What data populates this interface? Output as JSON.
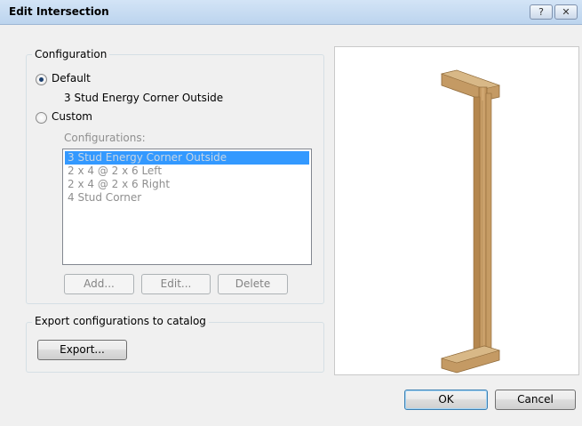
{
  "window": {
    "title": "Edit Intersection",
    "help_glyph": "?",
    "close_glyph": "✕"
  },
  "configuration": {
    "group_label": "Configuration",
    "default_label": "Default",
    "default_value": "3 Stud Energy Corner Outside",
    "custom_label": "Custom",
    "list_label": "Configurations:",
    "items": [
      "3 Stud Energy Corner Outside",
      "2 x 4 @ 2 x 6 Left",
      "2 x 4 @ 2 x 6 Right",
      "4 Stud Corner"
    ],
    "add_label": "Add...",
    "edit_label": "Edit...",
    "delete_label": "Delete"
  },
  "export": {
    "group_label": "Export configurations to catalog",
    "button_label": "Export..."
  },
  "footer": {
    "ok_label": "OK",
    "cancel_label": "Cancel"
  },
  "colors": {
    "selection": "#3399ff",
    "wood": "#c9a06a"
  }
}
